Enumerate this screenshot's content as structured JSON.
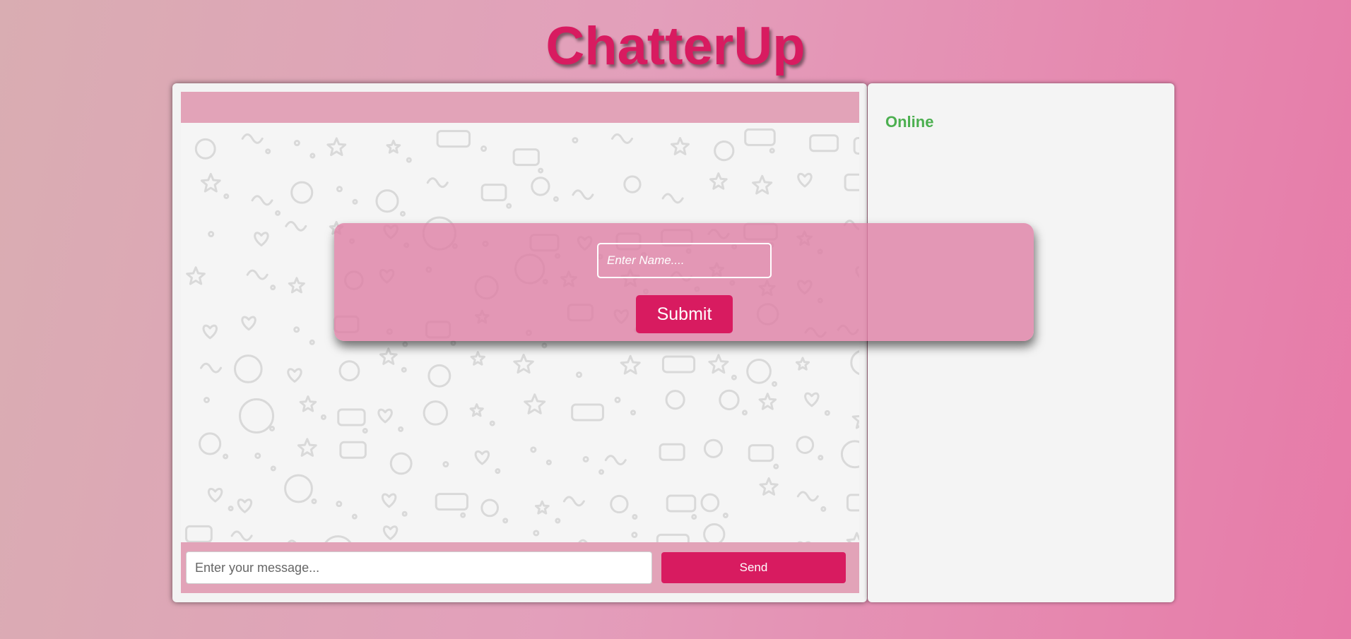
{
  "app": {
    "title": "ChatterUp"
  },
  "chat": {
    "message_placeholder": "Enter your message...",
    "send_label": "Send"
  },
  "online": {
    "heading": "Online"
  },
  "name_modal": {
    "name_placeholder": "Enter Name....",
    "submit_label": "Submit"
  },
  "colors": {
    "accent": "#d81b60",
    "header_bar": "#e2a3b8",
    "online_text": "#4caf50",
    "modal_background": "#de7ca3"
  },
  "icons": {
    "background_pattern": "doodle-pattern-icon"
  }
}
